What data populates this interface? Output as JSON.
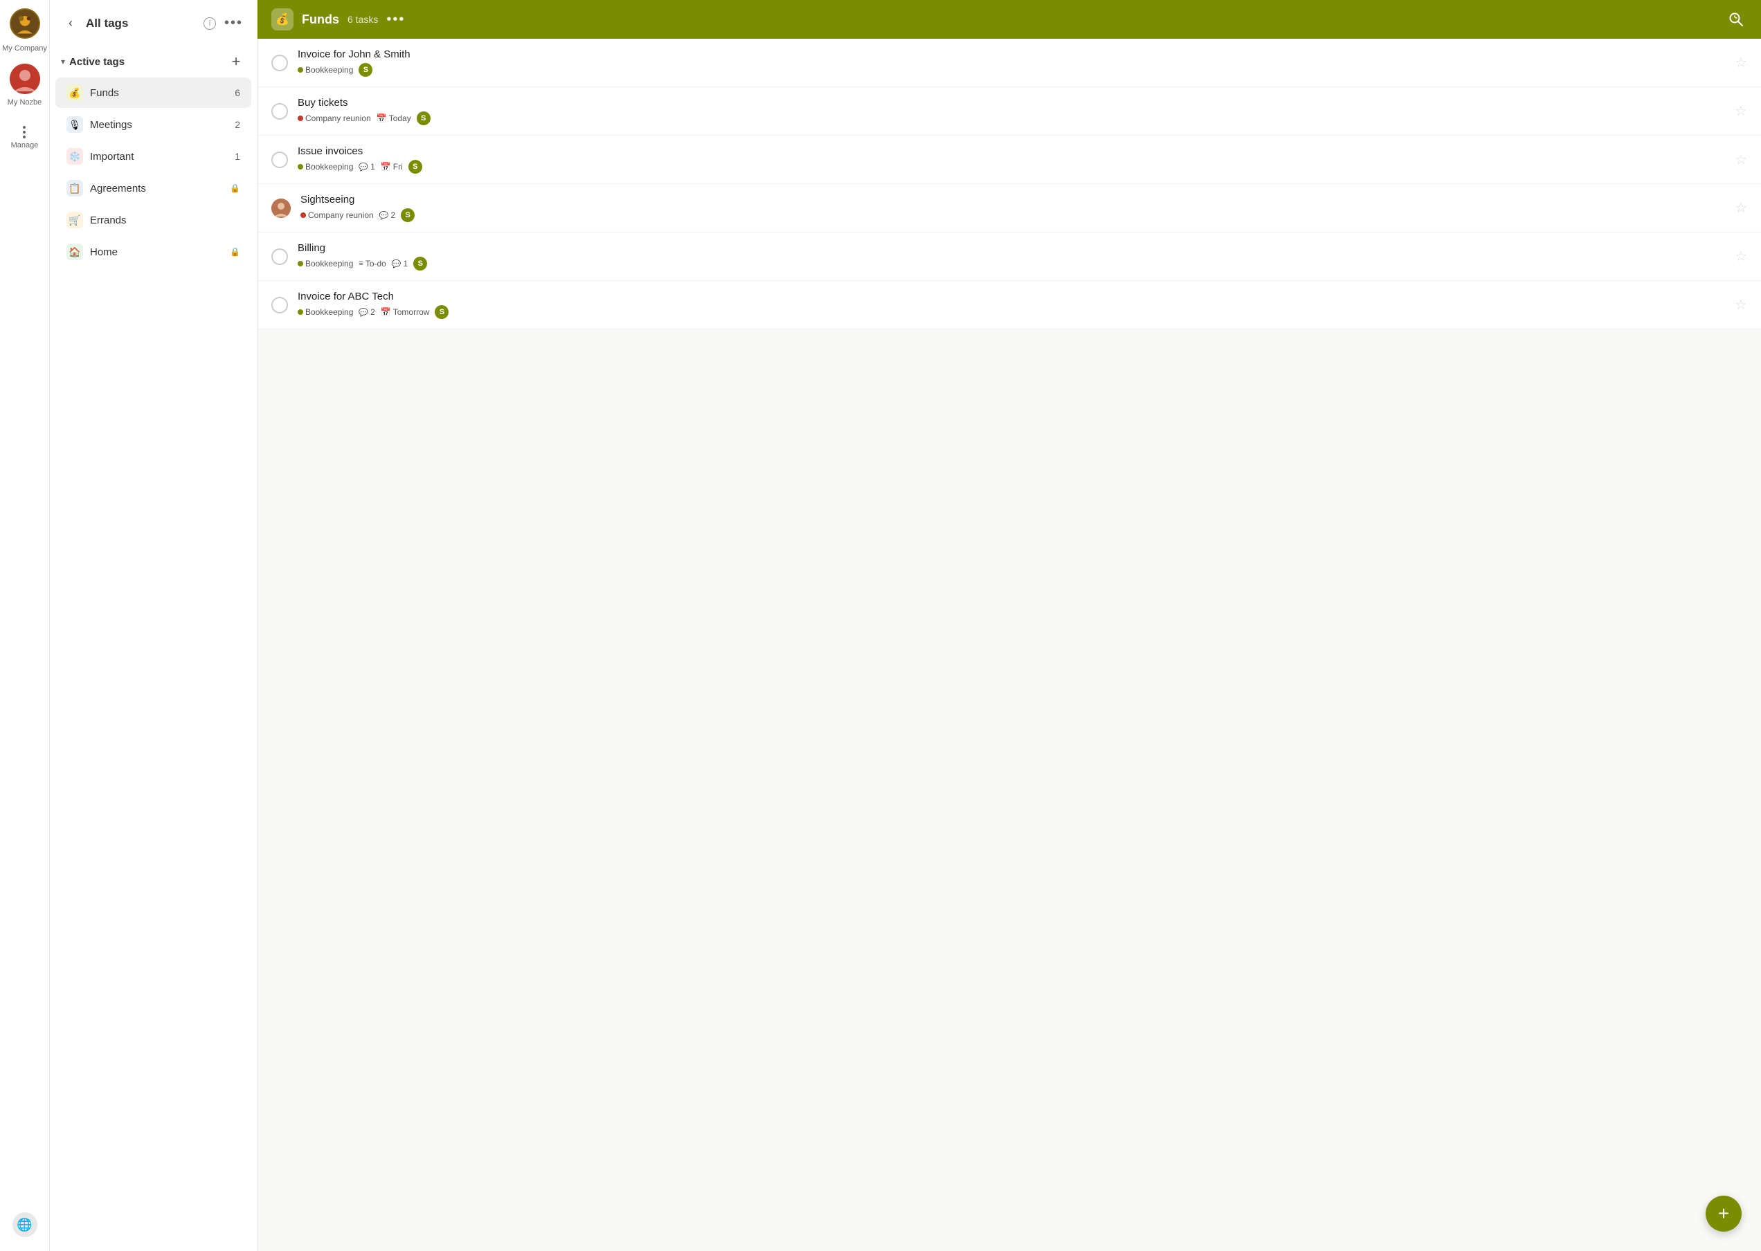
{
  "app": {
    "company": "My Company",
    "user": "My Nozbe",
    "manage": "Manage"
  },
  "sidebar": {
    "title": "All tags",
    "back_label": "‹",
    "more_label": "•••",
    "info_label": "i",
    "active_tags_label": "Active tags",
    "add_label": "+",
    "tags": [
      {
        "id": "funds",
        "name": "Funds",
        "icon": "💰",
        "icon_bg": "#f0f4d0",
        "count": 6,
        "active": true
      },
      {
        "id": "meetings",
        "name": "Meetings",
        "icon": "🎙️",
        "icon_bg": "#e8f0f8",
        "count": 2,
        "active": false
      },
      {
        "id": "important",
        "name": "Important",
        "icon": "❄️",
        "icon_bg": "#fde8e8",
        "count": 1,
        "active": false
      },
      {
        "id": "agreements",
        "name": "Agreements",
        "icon": "📋",
        "icon_bg": "#e8eef5",
        "count": null,
        "active": false,
        "locked": true
      },
      {
        "id": "errands",
        "name": "Errands",
        "icon": "🛒",
        "icon_bg": "#fff3e0",
        "count": null,
        "active": false
      },
      {
        "id": "home",
        "name": "Home",
        "icon": "🏠",
        "icon_bg": "#e8f5e8",
        "count": null,
        "active": false,
        "locked": true
      }
    ]
  },
  "main": {
    "header": {
      "title": "Funds",
      "task_count": "6 tasks",
      "more_label": "•••",
      "icon": "💰"
    },
    "tasks": [
      {
        "id": 1,
        "title": "Invoice for John & Smith",
        "has_avatar": false,
        "meta": [
          {
            "type": "tag",
            "dot": "green",
            "label": "Bookkeeping"
          },
          {
            "type": "person",
            "label": "S"
          }
        ]
      },
      {
        "id": 2,
        "title": "Buy tickets",
        "has_avatar": false,
        "meta": [
          {
            "type": "tag",
            "dot": "red",
            "label": "Company reunion"
          },
          {
            "type": "date",
            "label": "Today"
          },
          {
            "type": "person",
            "label": "S"
          }
        ]
      },
      {
        "id": 3,
        "title": "Issue invoices",
        "has_avatar": false,
        "meta": [
          {
            "type": "tag",
            "dot": "green",
            "label": "Bookkeeping"
          },
          {
            "type": "comment",
            "label": "1"
          },
          {
            "type": "date",
            "label": "Fri"
          },
          {
            "type": "person",
            "label": "S"
          }
        ]
      },
      {
        "id": 4,
        "title": "Sightseeing",
        "has_avatar": true,
        "meta": [
          {
            "type": "tag",
            "dot": "red",
            "label": "Company reunion"
          },
          {
            "type": "comment",
            "label": "2"
          },
          {
            "type": "person",
            "label": "S"
          }
        ]
      },
      {
        "id": 5,
        "title": "Billing",
        "has_avatar": false,
        "meta": [
          {
            "type": "tag",
            "dot": "green",
            "label": "Bookkeeping"
          },
          {
            "type": "status",
            "label": "To-do"
          },
          {
            "type": "comment",
            "label": "1"
          },
          {
            "type": "person",
            "label": "S"
          }
        ]
      },
      {
        "id": 6,
        "title": "Invoice for ABC Tech",
        "has_avatar": false,
        "meta": [
          {
            "type": "tag",
            "dot": "green",
            "label": "Bookkeeping"
          },
          {
            "type": "comment",
            "label": "2"
          },
          {
            "type": "date",
            "label": "Tomorrow"
          },
          {
            "type": "person",
            "label": "S"
          }
        ]
      }
    ]
  },
  "fab": {
    "label": "+"
  },
  "colors": {
    "header_bg": "#7a8c00",
    "tag_active_bg": "#f0f0f0",
    "funds_dot": "#7a8c00",
    "person_badge_bg": "#7a8c00"
  }
}
